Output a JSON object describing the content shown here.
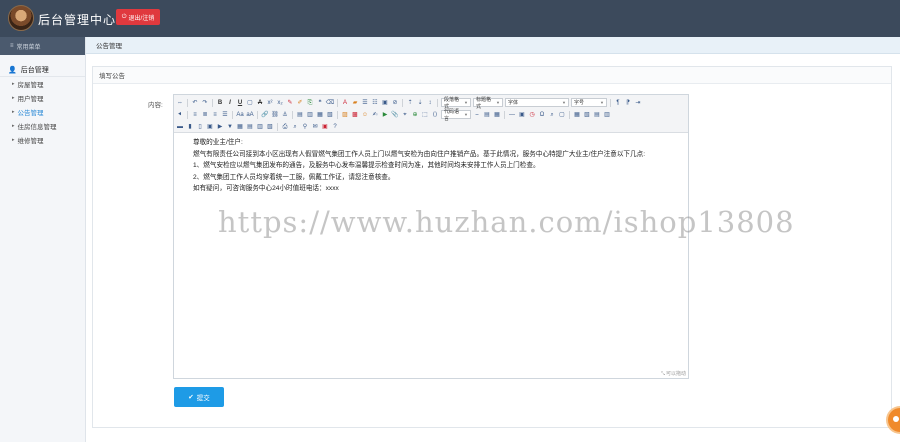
{
  "topbar": {
    "brand": "后台管理中心",
    "logout_label": "退出/注销"
  },
  "sidebar": {
    "header_label": "常用菜单",
    "group_label": "后台管理",
    "items": [
      {
        "label": "房屋管理"
      },
      {
        "label": "用户管理"
      },
      {
        "label": "公告管理"
      },
      {
        "label": "住房信息管理"
      },
      {
        "label": "维修管理"
      }
    ]
  },
  "breadcrumb": "公告管理",
  "panel": {
    "title": "填写公告",
    "content_label": "内容:",
    "toolbar_selects": {
      "para": "段落格式",
      "heading": "标题格式",
      "font_family": "字体",
      "font_size": "字号",
      "insert_code": "代码语言"
    },
    "editor_text": {
      "greeting": "尊敬的业主/住户:",
      "line1": "燃气有限责任公司接到本小区出现有人假冒燃气集团工作人员上门以燃气安检为由向住户推销产品。基于此情况，服务中心特提广大业主/住户注意以下几点:",
      "item1": "1、燃气安检应以燃气集团发布的通告，及服务中心发布温馨提示检查时间为准，其他时间均未安排工作人员上门检查。",
      "item2": "2、燃气集团工作人员均穿着统一工服，佩戴工作证，请您注意核查。",
      "contact": "如有疑问，可咨询服务中心24小时值班电话：xxxx"
    },
    "resize_label": "可以拖动",
    "submit_label": "提交"
  },
  "watermark": "https://www.huzhan.com/ishop13808",
  "colors": {
    "topbar": "#3c4a5c",
    "logout_button": "#e0393e",
    "submit_button": "#1e9be6",
    "active_link": "#2b8ad6"
  }
}
